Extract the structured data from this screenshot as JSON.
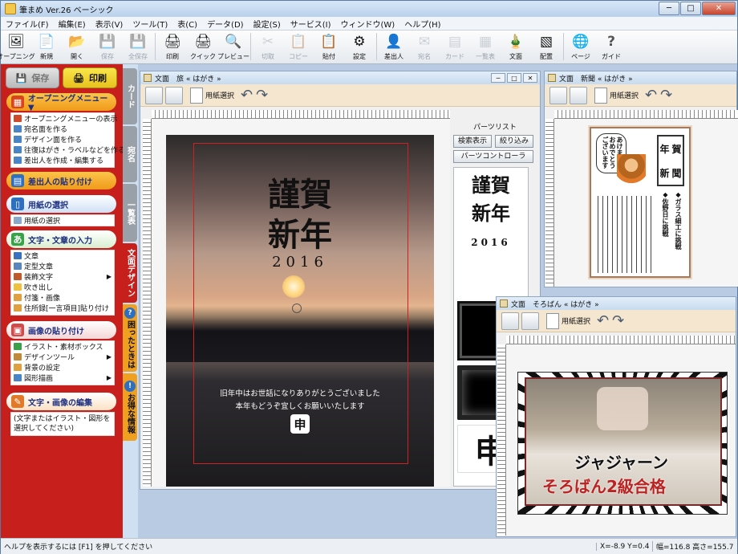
{
  "app": {
    "title": "筆まめ Ver.26 ベーシック",
    "minimize": "─",
    "maximize": "□",
    "close": "✕"
  },
  "menu": [
    "ファイル(F)",
    "編集(E)",
    "表示(V)",
    "ツール(T)",
    "表(C)",
    "データ(D)",
    "設定(S)",
    "サービス(I)",
    "ウィンドウ(W)",
    "ヘルプ(H)"
  ],
  "toolbar": [
    {
      "label": "オープニング",
      "icon": "opening-icon",
      "glyph": "🖼",
      "enabled": true
    },
    {
      "label": "新規",
      "icon": "new-document-icon",
      "glyph": "📄",
      "enabled": true
    },
    {
      "label": "開く",
      "icon": "open-folder-icon",
      "glyph": "📂",
      "enabled": true
    },
    {
      "label": "保存",
      "icon": "save-icon",
      "glyph": "💾",
      "enabled": false
    },
    {
      "label": "全保存",
      "icon": "save-all-icon",
      "glyph": "💾",
      "enabled": false
    },
    {
      "label": "印刷",
      "icon": "print-icon",
      "glyph": "🖨",
      "enabled": true
    },
    {
      "label": "クイック",
      "icon": "quick-print-icon",
      "glyph": "🖨",
      "enabled": true
    },
    {
      "label": "プレビュー",
      "icon": "preview-icon",
      "glyph": "🔍",
      "enabled": true
    },
    {
      "label": "切取",
      "icon": "cut-icon",
      "glyph": "✂",
      "enabled": false
    },
    {
      "label": "コピー",
      "icon": "copy-icon",
      "glyph": "📋",
      "enabled": false
    },
    {
      "label": "貼付",
      "icon": "paste-icon",
      "glyph": "📋",
      "enabled": true
    },
    {
      "label": "設定",
      "icon": "settings-icon",
      "glyph": "⚙",
      "enabled": true
    },
    {
      "label": "差出人",
      "icon": "sender-icon",
      "glyph": "👤",
      "enabled": true
    },
    {
      "label": "宛名",
      "icon": "address-icon",
      "glyph": "✉",
      "enabled": false
    },
    {
      "label": "カード",
      "icon": "card-icon",
      "glyph": "▤",
      "enabled": false
    },
    {
      "label": "一覧表",
      "icon": "list-icon",
      "glyph": "▦",
      "enabled": false
    },
    {
      "label": "文面",
      "icon": "design-icon",
      "glyph": "🎍",
      "enabled": true
    },
    {
      "label": "配置",
      "icon": "layout-icon",
      "glyph": "▧",
      "enabled": true
    },
    {
      "label": "ページ",
      "icon": "page-globe-icon",
      "glyph": "🌐",
      "enabled": true
    },
    {
      "label": "ガイド",
      "icon": "guide-icon",
      "glyph": "?",
      "enabled": true
    }
  ],
  "left": {
    "save": "保存",
    "print": "印刷",
    "sections": [
      {
        "title": "オープニングメニュー ▼",
        "items": [
          "オープニングメニューの表示",
          "宛名面を作る",
          "デザイン面を作る",
          "往復はがき・ラベルなどを作る",
          "差出人を作成・編集する"
        ]
      },
      {
        "title": "差出人の貼り付け",
        "items": []
      },
      {
        "title": "用紙の選択",
        "items": [
          "用紙の選択"
        ]
      },
      {
        "title": "文字・文章の入力",
        "items": [
          "文章",
          "定型文章",
          "装飾文字",
          "吹き出し",
          "付箋・画像",
          "住所録[一言項目]貼り付け"
        ]
      },
      {
        "title": "画像の貼り付け",
        "items": [
          "イラスト・素材ボックス",
          "デザインツール",
          "背景の設定",
          "図形描画"
        ]
      },
      {
        "title": "文字・画像の編集",
        "items": [
          "(文字またはイラスト・図形を選択してください)"
        ]
      }
    ]
  },
  "vtabs": [
    "カード",
    "宛名",
    "一覧表",
    "文面デザイン",
    "困ったときは",
    "お得な情報"
  ],
  "doc1": {
    "title": "文面　旅 « はがき »",
    "paper": "用紙選択",
    "greeting_line1": "謹賀",
    "greeting_line2": "新年",
    "year": "2016",
    "msg1": "旧年中はお世話になりありがとうございました",
    "msg2": "本年もどうぞ宜しくお願いいたします",
    "stamp": "申",
    "parts_title": "パーツリスト",
    "parts_search": "検索表示",
    "parts_filter": "絞り込み",
    "parts_controller": "パーツコントローラ"
  },
  "doc2": {
    "title": "文面　新聞 « はがき »",
    "paper": "用紙選択",
    "np_title1": "年",
    "np_title2": "賀",
    "np_title3": "新",
    "np_title4": "聞",
    "bubble": "あけましておめでとうございます",
    "headline1": "◆ガラス細工に挑戦",
    "headline2": "◆佐野日に挑戦"
  },
  "doc3": {
    "title": "文面　そろばん « はがき »",
    "paper": "用紙選択",
    "caption1": "ジャジャーン",
    "caption2": "そろばん2級合格"
  },
  "status": {
    "help": "ヘルプを表示するには [F1] を押してください",
    "coords": "X=-8.9 Y=0.4",
    "size": "幅=116.8 高さ=155.7"
  },
  "colors": {
    "accent_red": "#c71f1c",
    "orange": "#f0a020",
    "blue_tab": "#2f6fc0"
  }
}
